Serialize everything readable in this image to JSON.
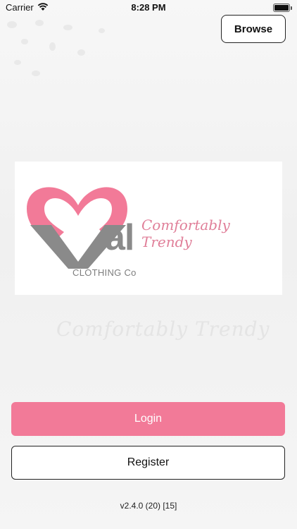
{
  "status_bar": {
    "carrier": "Carrier",
    "time": "8:28 PM"
  },
  "header": {
    "browse_label": "Browse"
  },
  "logo": {
    "brand_letters": "al",
    "subtitle": "CLOTHING Co",
    "tagline": "Comfortably Trendy",
    "heart_color": "#f27a98",
    "v_color": "#8a8a8a"
  },
  "background": {
    "tagline_watermark": "Comfortably Trendy"
  },
  "actions": {
    "login_label": "Login",
    "register_label": "Register"
  },
  "footer": {
    "version": "v2.4.0 (20) [15]"
  },
  "colors": {
    "accent": "#f27a98",
    "border": "#222222"
  }
}
